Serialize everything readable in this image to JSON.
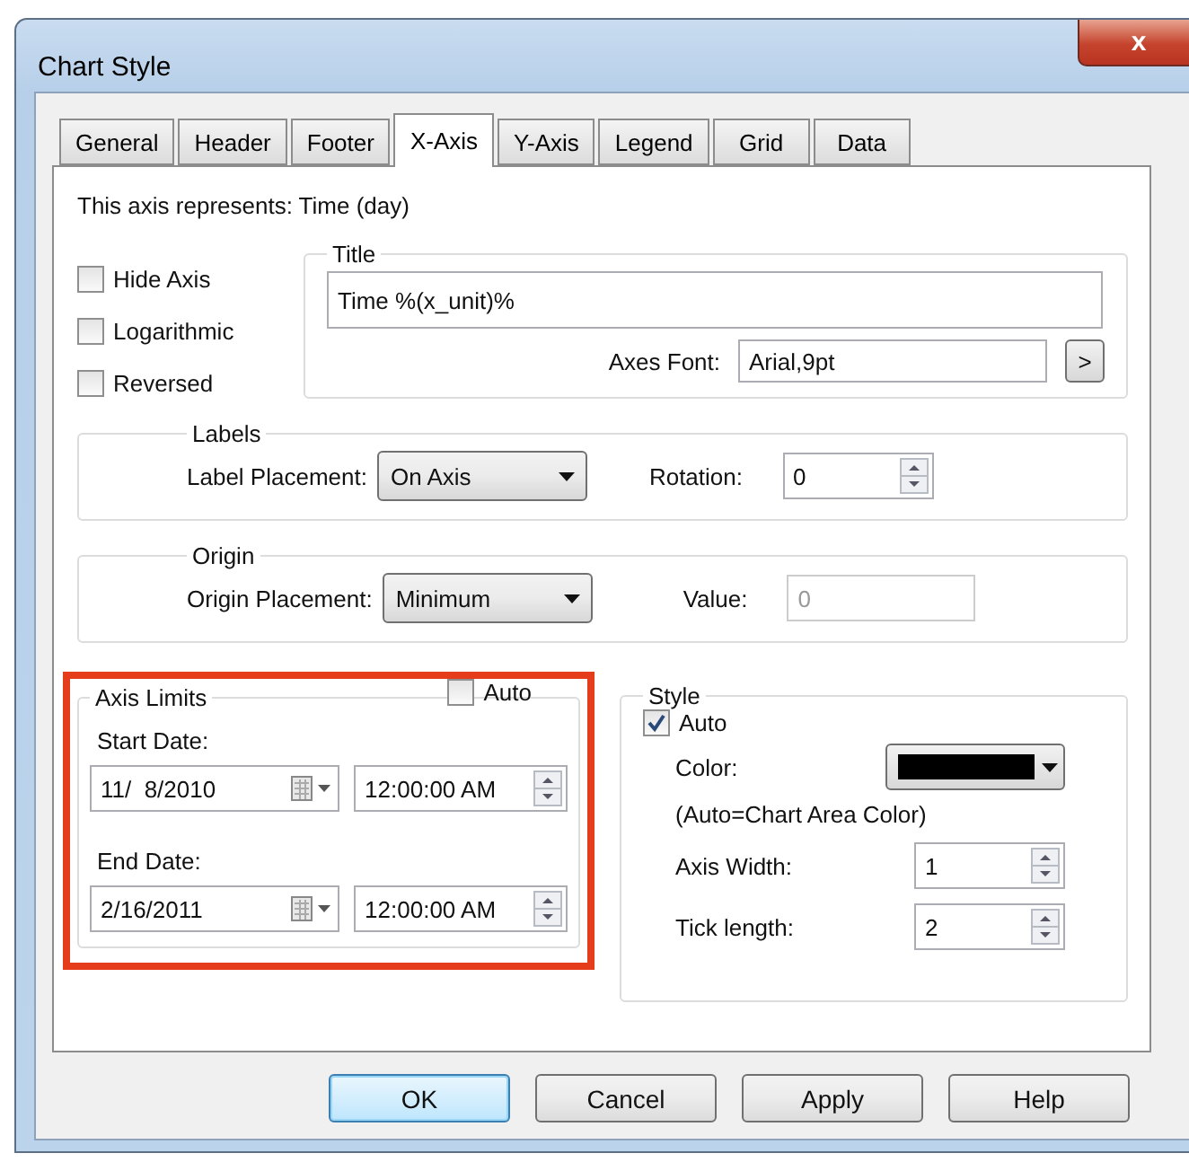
{
  "window": {
    "title": "Chart Style",
    "close": "x"
  },
  "tabs": [
    {
      "label": "General",
      "selected": false
    },
    {
      "label": "Header",
      "selected": false
    },
    {
      "label": "Footer",
      "selected": false
    },
    {
      "label": "X-Axis",
      "selected": true
    },
    {
      "label": "Y-Axis",
      "selected": false
    },
    {
      "label": "Legend",
      "selected": false
    },
    {
      "label": "Grid",
      "selected": false
    },
    {
      "label": "Data",
      "selected": false
    }
  ],
  "axis_description": "This axis represents: Time (day)",
  "options": [
    {
      "label": "Hide Axis",
      "checked": false
    },
    {
      "label": "Logarithmic",
      "checked": false
    },
    {
      "label": "Reversed",
      "checked": false
    }
  ],
  "title_group": {
    "legend": "Title",
    "value": "Time %(x_unit)%",
    "font_label": "Axes Font:",
    "font_value": "Arial,9pt",
    "font_button": ">"
  },
  "labels_group": {
    "legend": "Labels",
    "placement_label": "Label Placement:",
    "placement": "On Axis",
    "rotation_label": "Rotation:",
    "rotation": "0"
  },
  "origin_group": {
    "legend": "Origin",
    "placement_label": "Origin Placement:",
    "placement": "Minimum",
    "value_label": "Value:",
    "value": "0",
    "value_disabled": true
  },
  "axis_limits": {
    "legend": "Axis Limits",
    "auto_label": "Auto",
    "auto_checked": false,
    "highlighted": true,
    "rows": [
      {
        "label": "Start Date:",
        "date": "11/  8/2010",
        "time": "12:00:00 AM"
      },
      {
        "label": "End Date:",
        "date": "2/16/2011",
        "time": "12:00:00 AM"
      }
    ]
  },
  "style_group": {
    "legend": "Style",
    "auto_label": "Auto",
    "auto_checked": true,
    "color_label": "Color:",
    "color": "#000000",
    "color_note": "(Auto=Chart Area Color)",
    "fields": [
      {
        "label": "Axis Width:",
        "value": "1"
      },
      {
        "label": "Tick length:",
        "value": "2"
      }
    ]
  },
  "buttons": [
    {
      "label": "OK",
      "default": true
    },
    {
      "label": "Cancel",
      "default": false
    },
    {
      "label": "Apply",
      "default": false
    },
    {
      "label": "Help",
      "default": false
    }
  ]
}
